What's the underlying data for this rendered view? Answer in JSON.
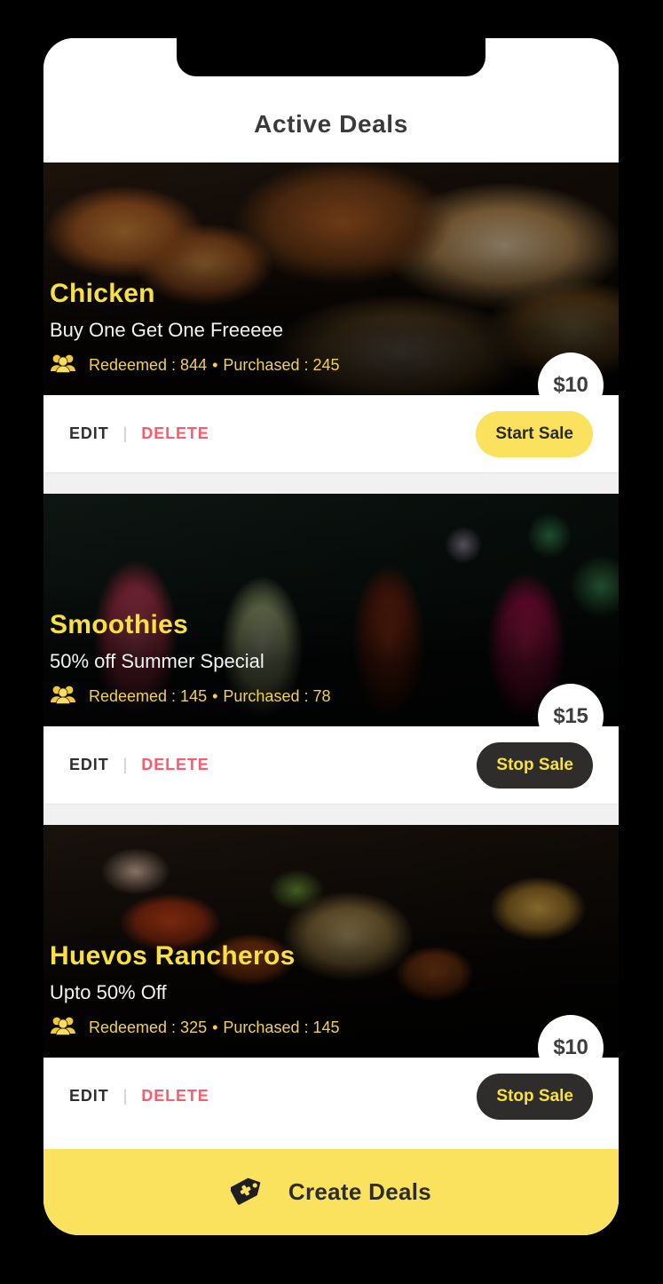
{
  "header": {
    "title": "Active Deals"
  },
  "colors": {
    "accent_yellow": "#fae15e",
    "deal_title_yellow": "#f7e03f",
    "stats_yellow": "#f2d24b",
    "delete_red": "#fb5c6c",
    "dark_button": "#2f2d2b",
    "page_background": "#000000",
    "card_background": "#ffffff"
  },
  "common": {
    "edit_label": "EDIT",
    "delete_label": "DELETE",
    "separator": "|",
    "people_icon": "people-group-icon",
    "stats_separator": "•"
  },
  "deals": [
    {
      "name": "Chicken",
      "subtitle": "Buy One Get One Freeeee",
      "redeemed_label": "Redeemed : 844",
      "purchased_label": "Purchased : 245",
      "redeemed": 844,
      "purchased": 245,
      "price": "$10",
      "sale_button_label": "Start Sale",
      "sale_state": "start",
      "image": "grilled-meat-photo"
    },
    {
      "name": "Smoothies",
      "subtitle": "50% off Summer Special",
      "redeemed_label": "Redeemed : 145",
      "purchased_label": "Purchased : 78",
      "redeemed": 145,
      "purchased": 78,
      "price": "$15",
      "sale_button_label": "Stop Sale",
      "sale_state": "stop",
      "image": "cocktail-drinks-photo"
    },
    {
      "name": "Huevos Rancheros",
      "subtitle": "Upto 50% Off",
      "redeemed_label": "Redeemed : 325",
      "purchased_label": "Purchased : 145",
      "redeemed": 325,
      "purchased": 145,
      "price": "$10",
      "sale_button_label": "Stop Sale",
      "sale_state": "stop",
      "image": "grilled-vegetables-photo"
    }
  ],
  "bottom_bar": {
    "label": "Create Deals",
    "icon": "tag-plus-icon"
  }
}
